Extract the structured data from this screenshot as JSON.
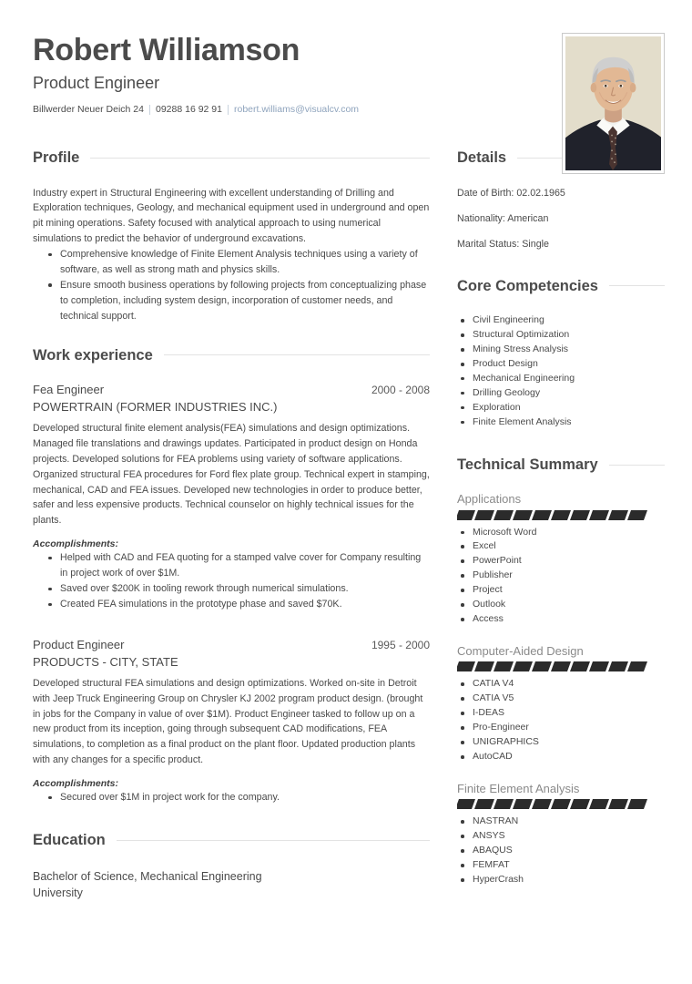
{
  "header": {
    "name": "Robert Williamson",
    "job_title": "Product Engineer",
    "contact": {
      "address": "Billwerder Neuer Deich 24",
      "phone": "09288 16 92 91",
      "email": "robert.williams@visualcv.com",
      "email_color": "#8fa4bd"
    },
    "photo_alt": "portrait-photo"
  },
  "profile": {
    "heading": "Profile",
    "paragraph": "Industry expert in Structural Engineering with excellent understanding of Drilling and Exploration techniques, Geology, and mechanical equipment used in underground and open pit mining operations. Safety focused with analytical approach to using numerical simulations to predict the behavior of underground excavations.",
    "bullets": [
      "Comprehensive knowledge of Finite Element Analysis techniques using a variety of software, as well as strong math and physics skills.",
      "Ensure smooth business operations by following projects from conceptualizing phase to completion, including system design, incorporation of customer needs, and technical support."
    ]
  },
  "work_experience": {
    "heading": "Work experience",
    "accomplishments_label": "Accomplishments:",
    "jobs": [
      {
        "role": "Fea Engineer",
        "date": "2000 - 2008",
        "company": "POWERTRAIN (FORMER INDUSTRIES INC.)",
        "description": "Developed structural finite element analysis(FEA) simulations and design optimizations. Managed file translations and drawings updates. Participated in product design on Honda projects. Developed solutions for FEA problems using variety of software applications. Organized structural FEA procedures for Ford flex plate group. Technical expert in stamping, mechanical, CAD and FEA issues. Developed new technologies in order to produce better, safer and less expensive products. Technical counselor on highly technical issues for the plants.",
        "accomplishments": [
          "Helped with CAD and FEA quoting for a stamped valve cover for Company resulting in project work of over $1M.",
          "Saved over $200K in tooling rework through numerical simulations.",
          "Created FEA simulations in the prototype phase and saved $70K."
        ]
      },
      {
        "role": "Product Engineer",
        "date": "1995 - 2000",
        "company": "PRODUCTS - CITY, STATE",
        "description": "Developed structural FEA simulations and design optimizations. Worked on-site in Detroit with Jeep Truck Engineering Group on Chrysler KJ 2002 program product design. (brought in jobs for the Company in value of over $1M). Product Engineer tasked to follow up on a new product from its inception, going through subsequent CAD modifications, FEA simulations, to completion as a final product on the plant floor. Updated production plants with any changes for a specific product.",
        "accomplishments": [
          "Secured over $1M in project work for the company."
        ]
      }
    ]
  },
  "education": {
    "heading": "Education",
    "entries": [
      {
        "degree": "Bachelor of Science, Mechanical Engineering",
        "school": "University"
      }
    ]
  },
  "details": {
    "heading": "Details",
    "lines": [
      "Date of Birth: 02.02.1965",
      "Nationality: American",
      "Marital Status: Single"
    ]
  },
  "core_competencies": {
    "heading": "Core Competencies",
    "items": [
      "Civil Engineering",
      "Structural Optimization",
      "Mining Stress Analysis",
      "Product Design",
      "Mechanical Engineering",
      "Drilling Geology",
      "Exploration",
      "Finite Element Analysis"
    ]
  },
  "technical_summary": {
    "heading": "Technical Summary",
    "groups": [
      {
        "label": "Applications",
        "level": 10,
        "items": [
          "Microsoft Word",
          "Excel",
          "PowerPoint",
          "Publisher",
          "Project",
          "Outlook",
          "Access"
        ]
      },
      {
        "label": "Computer-Aided Design",
        "level": 10,
        "items": [
          "CATIA V4",
          "CATIA V5",
          "I-DEAS",
          "Pro-Engineer",
          "UNIGRAPHICS",
          "AutoCAD"
        ]
      },
      {
        "label": "Finite Element Analysis",
        "level": 10,
        "items": [
          "NASTRAN",
          "ANSYS",
          "ABAQUS",
          "FEMFAT",
          "HyperCrash"
        ]
      }
    ]
  }
}
